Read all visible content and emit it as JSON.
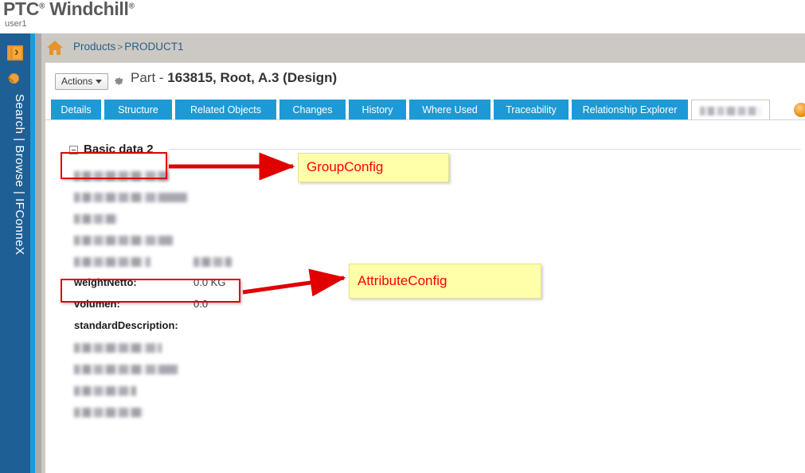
{
  "brand": {
    "name": "PTC",
    "product": "Windchill",
    "registered_mark": "®",
    "user": "user1"
  },
  "sidebar": {
    "expand_icon": "expand-panel-icon",
    "pin_icon": "pin-icon",
    "label": "Search | Browse | IFConneX"
  },
  "breadcrumb": {
    "home_icon": "home-icon",
    "root": "Products",
    "separator": ">",
    "current": "PRODUCT1"
  },
  "toolbar": {
    "actions_label": "Actions",
    "gear_icon": "gear-icon",
    "object_type": "Part - ",
    "object_id": "163815, Root, A.3 (Design)"
  },
  "tabs": [
    {
      "label": "Details",
      "active": false,
      "redacted": false
    },
    {
      "label": "Structure",
      "active": false,
      "redacted": false
    },
    {
      "label": "Related Objects",
      "active": false,
      "redacted": false
    },
    {
      "label": "Changes",
      "active": false,
      "redacted": false
    },
    {
      "label": "History",
      "active": false,
      "redacted": false
    },
    {
      "label": "Where Used",
      "active": false,
      "redacted": false
    },
    {
      "label": "Traceability",
      "active": false,
      "redacted": false
    },
    {
      "label": "Relationship Explorer",
      "active": false,
      "redacted": false
    },
    {
      "label": "",
      "active": true,
      "redacted": true
    }
  ],
  "group": {
    "toggle_icon": "collapse-minus-icon",
    "title": "Basic data 2"
  },
  "attributes": [
    {
      "label": "",
      "value": "",
      "redacted": true,
      "label_w": 118,
      "value_w": 0
    },
    {
      "label": "",
      "value": "",
      "redacted": true,
      "label_w": 142,
      "value_w": 0
    },
    {
      "label": "",
      "value": "",
      "redacted": true,
      "label_w": 56,
      "value_w": 0
    },
    {
      "label": "",
      "value": "",
      "redacted": true,
      "label_w": 124,
      "value_w": 0
    },
    {
      "label": "",
      "value": "",
      "redacted": true,
      "label_w": 96,
      "value_w": 48
    },
    {
      "label": "weightNetto:",
      "value": "0.0 KG",
      "redacted": false,
      "label_w": 0,
      "value_w": 0
    },
    {
      "label": "volumen:",
      "value": "0.0",
      "redacted": false,
      "label_w": 0,
      "value_w": 0
    },
    {
      "label": "standardDescription:",
      "value": "",
      "redacted": false,
      "label_w": 0,
      "value_w": 0
    },
    {
      "label": "",
      "value": "",
      "redacted": true,
      "label_w": 110,
      "value_w": 0
    },
    {
      "label": "",
      "value": "",
      "redacted": true,
      "label_w": 130,
      "value_w": 0
    },
    {
      "label": "",
      "value": "",
      "redacted": true,
      "label_w": 78,
      "value_w": 0
    },
    {
      "label": "",
      "value": "",
      "redacted": true,
      "label_w": 88,
      "value_w": 0
    }
  ],
  "annotations": [
    {
      "text": "GroupConfig",
      "name": "group-config-annotation"
    },
    {
      "text": "AttributeConfig",
      "name": "attribute-config-annotation"
    }
  ],
  "colors": {
    "rail_blue": "#1e6096",
    "accent_cyan": "#1c9ad6",
    "chrome_gray": "#ccc9c4",
    "annotation_red": "#ff0000",
    "annotation_yellow": "#ffffaa",
    "brand_orange": "#e8922a",
    "link_blue": "#2c5d87"
  }
}
